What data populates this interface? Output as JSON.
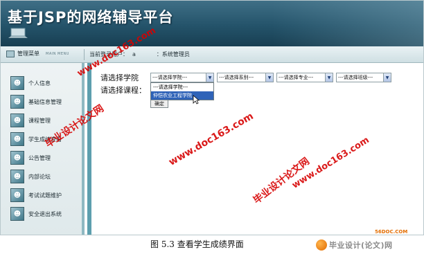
{
  "banner": {
    "title": "基于JSP的网络辅导平台"
  },
  "navbar": {
    "menu_label": "管理菜单",
    "menu_en": "MAIN MENU",
    "login_prefix": "当前登录用户：",
    "login_user": "a",
    "login_role": "：系统管理员"
  },
  "sidebar": {
    "items": [
      {
        "label": "个人信息",
        "icon": "user-info-icon"
      },
      {
        "label": "基础信息管理",
        "icon": "base-info-icon"
      },
      {
        "label": "课程管理",
        "icon": "course-icon"
      },
      {
        "label": "学生成绩查看",
        "icon": "grades-icon"
      },
      {
        "label": "公告管理",
        "icon": "notice-icon"
      },
      {
        "label": "内部论坛",
        "icon": "forum-icon"
      },
      {
        "label": "考试试题维护",
        "icon": "exam-icon"
      },
      {
        "label": "安全退出系统",
        "icon": "logout-icon"
      }
    ]
  },
  "form": {
    "select_label": "请选择学院",
    "course_label": "请选择课程：",
    "college_select": "---请选择学院---",
    "dept_select": "---请选择系别---",
    "major_select": "---请选择专业---",
    "class_select": "---请选择班级---",
    "dropdown_options": [
      "---请选择学院---",
      "仲恺农业工程学院"
    ],
    "dropdown_highlight_index": 1,
    "confirm_button": "确定"
  },
  "watermarks": [
    "www.doc163.com",
    "毕业设计论文网",
    "www.doc163.com",
    "毕业设计论文网",
    "www.doc163.com"
  ],
  "caption": "图 5.3 查看学生成绩界面",
  "logo": {
    "text": "毕业设计(论文)网",
    "site": "56DOC.COM"
  },
  "colors": {
    "banner": "#24536a",
    "highlight": "#2f63b8",
    "watermark": "#d60000"
  }
}
